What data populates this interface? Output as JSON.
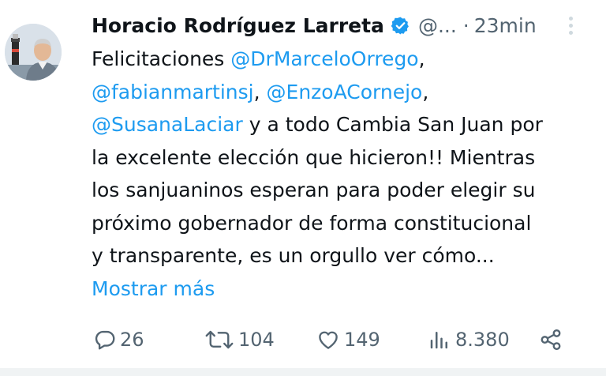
{
  "author": {
    "name": "Horacio Rodríguez Larreta",
    "handle": "@...",
    "separator": "·",
    "time": "23min"
  },
  "body": {
    "lines": [
      [
        {
          "t": "Felicitaciones "
        },
        {
          "t": "@DrMarceloOrrego",
          "m": true
        },
        {
          "t": ","
        }
      ],
      [
        {
          "t": "@fabianmartinsj",
          "m": true
        },
        {
          "t": ", "
        },
        {
          "t": "@EnzoACornejo",
          "m": true
        },
        {
          "t": ","
        }
      ],
      [
        {
          "t": "@SusanaLaciar",
          "m": true
        },
        {
          "t": " y a todo Cambia San Juan por"
        }
      ],
      [
        {
          "t": "la excelente elección que hicieron!! Mientras"
        }
      ],
      [
        {
          "t": "los sanjuaninos esperan para poder elegir su"
        }
      ],
      [
        {
          "t": "próximo gobernador de forma constitucional"
        }
      ],
      [
        {
          "t": "y transparente, es un orgullo ver cómo..."
        }
      ]
    ],
    "show_more": "Mostrar más"
  },
  "actions": {
    "replies": "26",
    "reposts": "104",
    "likes": "149",
    "views": "8.380"
  },
  "colors": {
    "accent": "#1d9bf0",
    "text": "#0f1419",
    "muted": "#536471"
  },
  "icons": [
    "verified-badge-icon",
    "more-options-icon",
    "reply-icon",
    "repost-icon",
    "like-icon",
    "views-icon",
    "share-icon"
  ]
}
